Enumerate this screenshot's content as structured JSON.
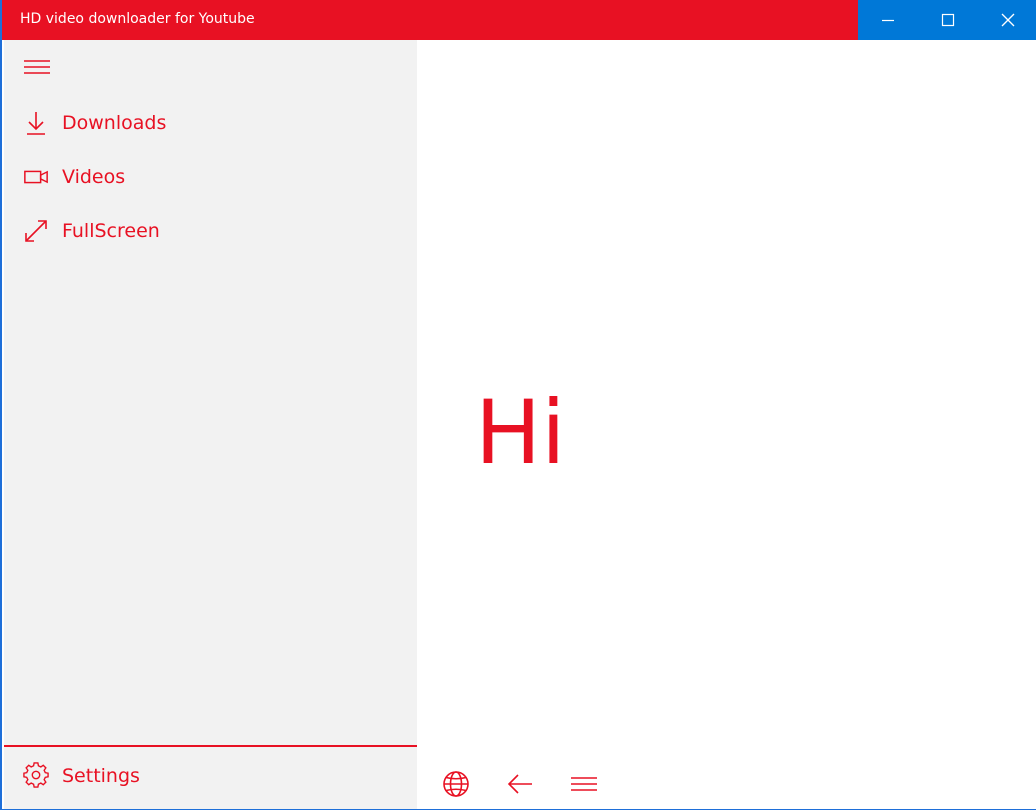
{
  "window": {
    "title": "HD video downloader for Youtube",
    "accent_color": "#e81123",
    "controls_color": "#0078d7",
    "controls": [
      {
        "name": "minimize",
        "icon": "minimize-icon"
      },
      {
        "name": "maximize",
        "icon": "maximize-icon"
      },
      {
        "name": "close",
        "icon": "close-icon"
      }
    ]
  },
  "sidebar": {
    "menu_icon": "hamburger-icon",
    "items": [
      {
        "label": "Downloads",
        "icon": "download-icon"
      },
      {
        "label": "Videos",
        "icon": "video-camera-icon"
      },
      {
        "label": "FullScreen",
        "icon": "fullscreen-icon"
      }
    ],
    "settings": {
      "label": "Settings",
      "icon": "gear-icon"
    }
  },
  "main": {
    "greeting": "Hi",
    "bottom_bar": [
      {
        "name": "globe",
        "icon": "globe-icon"
      },
      {
        "name": "back",
        "icon": "back-arrow-icon"
      },
      {
        "name": "menu",
        "icon": "hamburger-icon"
      }
    ]
  }
}
